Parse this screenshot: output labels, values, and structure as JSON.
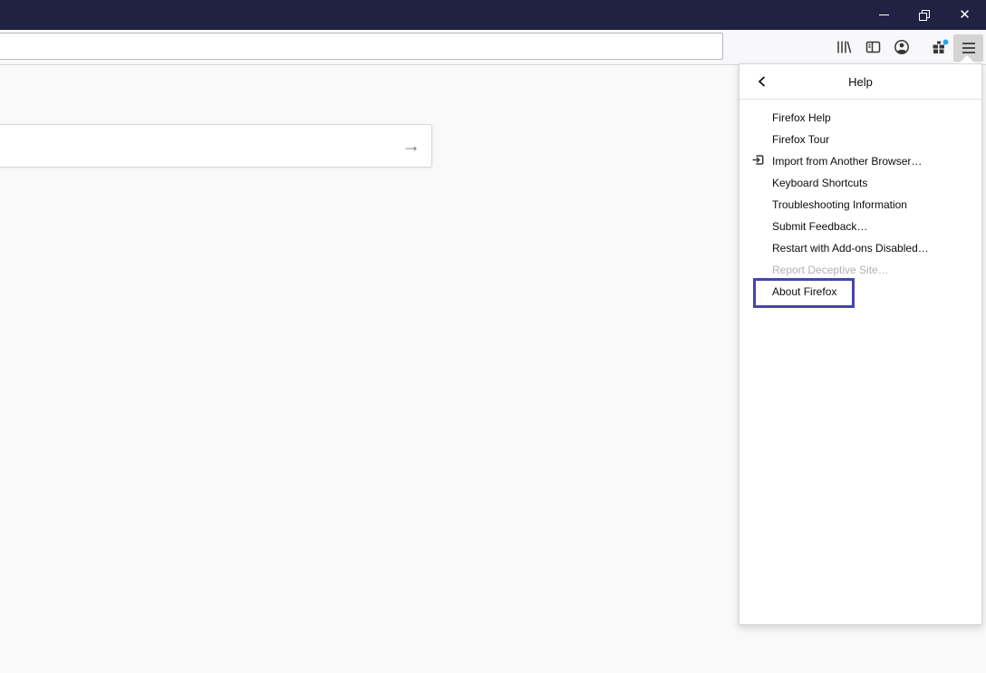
{
  "titlebar": {
    "controls": {
      "minimize": "minimize",
      "restore": "restore",
      "close": "close"
    },
    "close_glyph": "✕",
    "color": "#202244"
  },
  "toolbar": {
    "address_bar": {
      "value": "",
      "placeholder": ""
    },
    "icons": [
      "library-icon",
      "sidebar-icon",
      "account-icon",
      "gift-icon",
      "menu-icon"
    ],
    "notification_dot_color": "#2aa7f0"
  },
  "page": {
    "background": "#f9f9fa",
    "search": {
      "value": "",
      "placeholder": "",
      "go_glyph": "→"
    }
  },
  "panel": {
    "header": {
      "title": "Help",
      "back_icon": "back-chevron"
    },
    "items": [
      {
        "label": "Firefox Help",
        "state": "normal"
      },
      {
        "label": "Firefox Tour",
        "state": "normal"
      },
      {
        "label": "Import from Another Browser…",
        "state": "normal",
        "icon": "import-icon"
      },
      {
        "label": "Keyboard Shortcuts",
        "state": "normal"
      },
      {
        "label": "Troubleshooting Information",
        "state": "normal"
      },
      {
        "label": "Submit Feedback…",
        "state": "normal"
      },
      {
        "label": "Restart with Add-ons Disabled…",
        "state": "normal"
      },
      {
        "label": "Report Deceptive Site…",
        "state": "disabled"
      },
      {
        "label": "About Firefox",
        "state": "highlighted"
      }
    ],
    "highlight_border_color": "#4545b0",
    "disabled_text_color": "#b1b1b3"
  }
}
